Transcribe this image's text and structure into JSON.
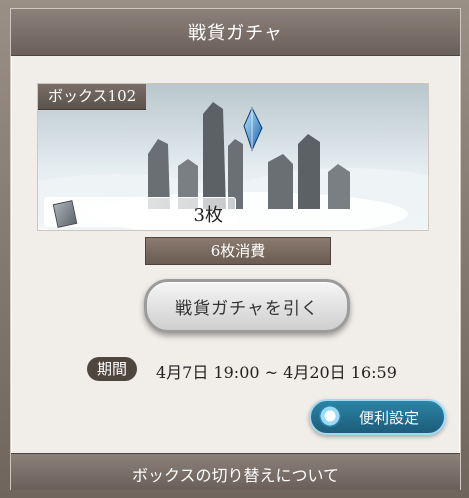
{
  "header": {
    "title": "戦貨ガチャ"
  },
  "box": {
    "label": "ボックス102",
    "count": "3枚"
  },
  "consume": {
    "label": "6枚消費"
  },
  "pull": {
    "label": "戦貨ガチャを引く"
  },
  "period": {
    "label": "期間",
    "text": "4月7日 19:00 ~ 4月20日 16:59"
  },
  "settings": {
    "label": "便利設定"
  },
  "footer": {
    "label": "ボックスの切り替えについて"
  },
  "icons": {
    "gear": "gear-icon",
    "ticket": "ticket-icon"
  },
  "colors": {
    "settingsBlue": "#1d5c7a",
    "panelBrown": "#6a5c52"
  }
}
